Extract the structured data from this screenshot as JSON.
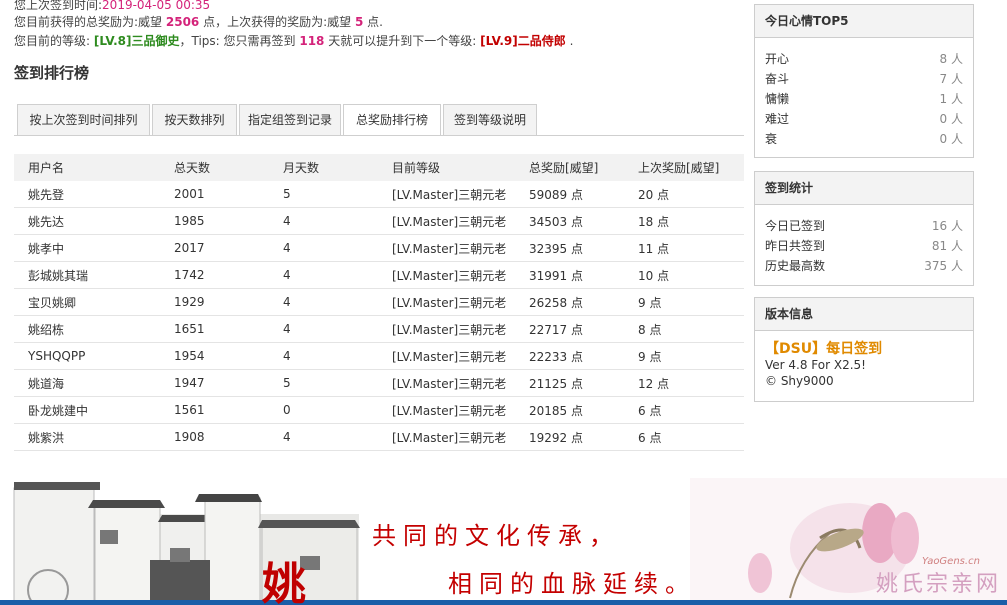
{
  "info": {
    "last_signin_prefix": "您上次签到时间:",
    "last_signin_time": "2019-04-05 00:35",
    "reward_prefix": "您目前获得的总奖励为:威望",
    "reward_total": "2506",
    "reward_mid": "点，上次获得的奖励为:威望",
    "reward_last": "5",
    "reward_suffix": "点.",
    "level_prefix": "您目前的等级:",
    "level_current": "[LV.8]三品御史",
    "level_tips": "，Tips: 您只需再签到",
    "days_needed": "118",
    "level_tips2": "天就可以提升到下一个等级:",
    "level_next": "[LV.9]二品侍郎",
    "level_end": "."
  },
  "section_title": "签到排行榜",
  "tabs": [
    "按上次签到时间排列",
    "按天数排列",
    "指定组签到记录",
    "总奖励排行榜",
    "签到等级说明"
  ],
  "table": {
    "headers": [
      "用户名",
      "总天数",
      "月天数",
      "目前等级",
      "总奖励[威望]",
      "上次奖励[威望]"
    ],
    "rows": [
      [
        "姚先登",
        "2001",
        "5",
        "[LV.Master]三朝元老",
        "59089 点",
        "20 点"
      ],
      [
        "姚先达",
        "1985",
        "4",
        "[LV.Master]三朝元老",
        "34503 点",
        "18 点"
      ],
      [
        "姚孝中",
        "2017",
        "4",
        "[LV.Master]三朝元老",
        "32395 点",
        "11 点"
      ],
      [
        "彭城姚其瑞",
        "1742",
        "4",
        "[LV.Master]三朝元老",
        "31991 点",
        "10 点"
      ],
      [
        "宝贝姚卿",
        "1929",
        "4",
        "[LV.Master]三朝元老",
        "26258 点",
        "9 点"
      ],
      [
        "姚绍栋",
        "1651",
        "4",
        "[LV.Master]三朝元老",
        "22717 点",
        "8 点"
      ],
      [
        "YSHQQPP",
        "1954",
        "4",
        "[LV.Master]三朝元老",
        "22233 点",
        "9 点"
      ],
      [
        "姚道海",
        "1947",
        "5",
        "[LV.Master]三朝元老",
        "21125 点",
        "12 点"
      ],
      [
        "卧龙姚建中",
        "1561",
        "0",
        "[LV.Master]三朝元老",
        "20185 点",
        "6 点"
      ],
      [
        "姚紫洪",
        "1908",
        "4",
        "[LV.Master]三朝元老",
        "19292 点",
        "6 点"
      ]
    ]
  },
  "mood": {
    "title": "今日心情TOP5",
    "items": [
      {
        "label": "开心",
        "value": "8 人"
      },
      {
        "label": "奋斗",
        "value": "7 人"
      },
      {
        "label": "慵懒",
        "value": "1 人"
      },
      {
        "label": "难过",
        "value": "0 人"
      },
      {
        "label": "衰",
        "value": "0 人"
      }
    ]
  },
  "stats": {
    "title": "签到统计",
    "items": [
      {
        "label": "今日已签到",
        "value": "16 人"
      },
      {
        "label": "昨日共签到",
        "value": "81 人"
      },
      {
        "label": "历史最高数",
        "value": "375 人"
      }
    ]
  },
  "version": {
    "title": "版本信息",
    "tag": "【DSU】",
    "name": "每日签到",
    "line2": "Ver 4.8 For X2.5!",
    "line3": "© Shy9000"
  },
  "banner": {
    "line1": "共同的文化传承，",
    "line2": "相同的血脉延续。",
    "char": "姚",
    "logo": "姚氏宗亲网",
    "url": "YaoGens.cn"
  },
  "colors": {
    "accent_red": "#d4237a",
    "level_green": "#2e8b1f",
    "level_next_red": "#c20000",
    "banner_red": "#c40000"
  }
}
